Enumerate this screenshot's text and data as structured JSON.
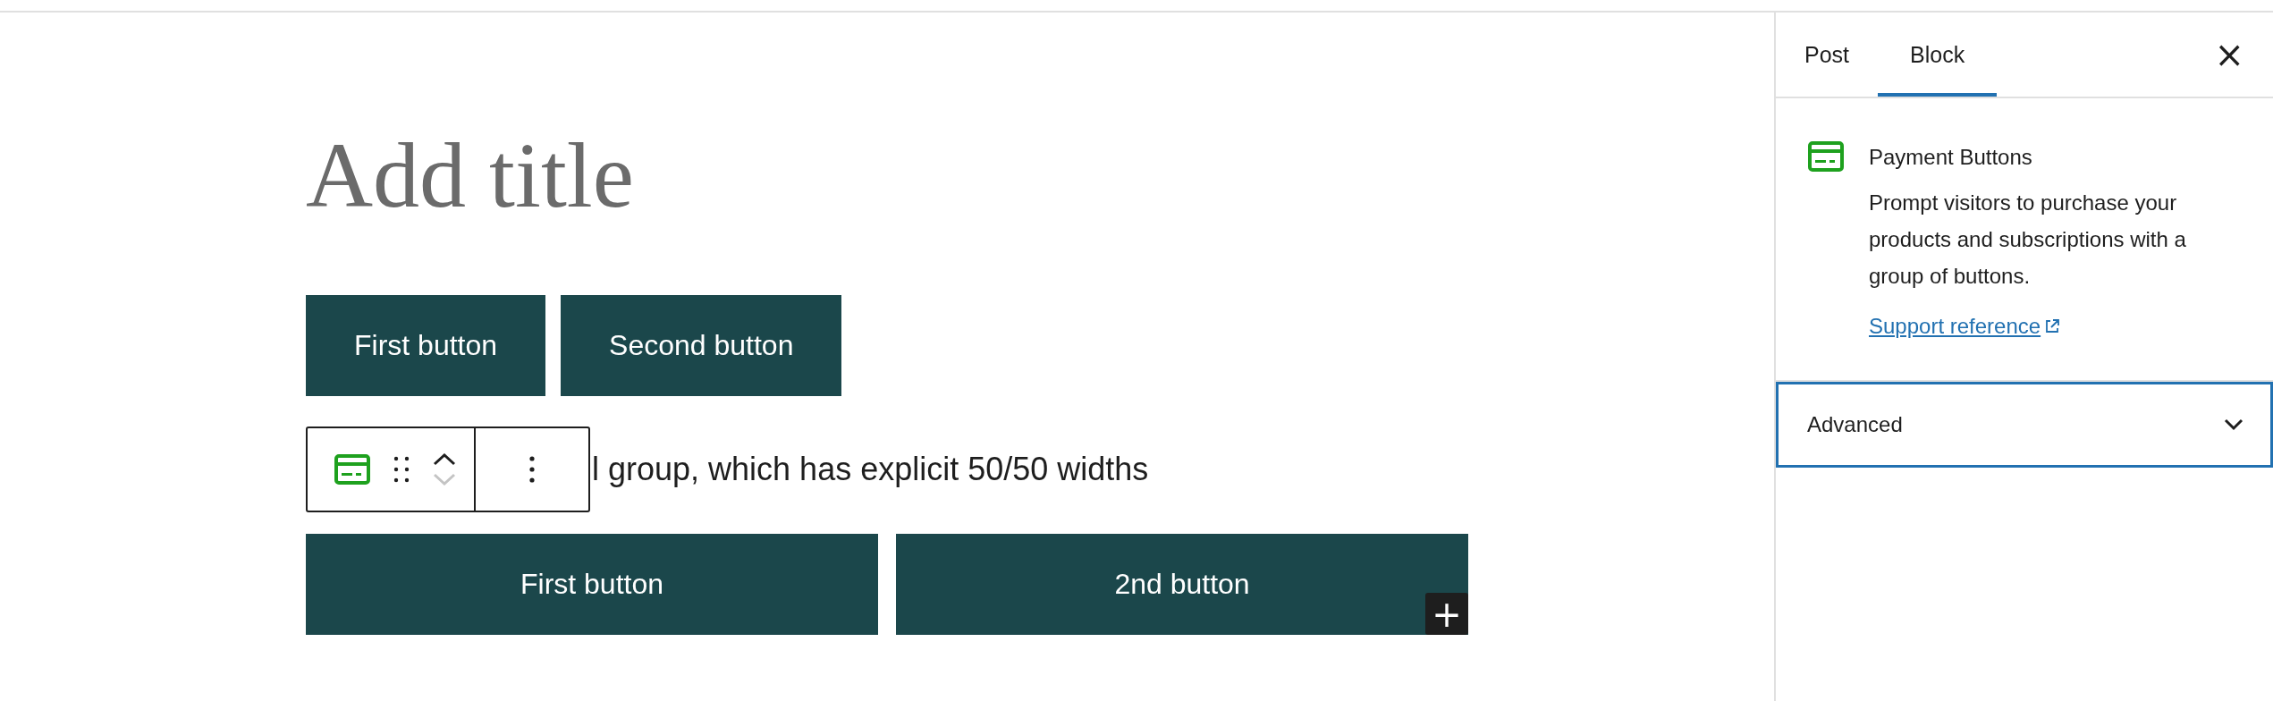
{
  "editor": {
    "title_placeholder": "Add title",
    "button_rows": [
      {
        "kind": "auto",
        "buttons": [
          "First button",
          "Second button"
        ]
      },
      {
        "kind": "equal",
        "buttons": [
          "First button",
          "2nd button"
        ]
      }
    ],
    "paragraph": "l group, which has explicit 50/50 widths",
    "toolbar": {
      "movers": [
        {
          "kind": "up",
          "disabled": false
        },
        {
          "kind": "down",
          "disabled": true
        }
      ]
    },
    "inserter": "+"
  },
  "sidebar": {
    "tabs": [
      {
        "label": "Post",
        "selected": false
      },
      {
        "label": "Block",
        "selected": true
      }
    ],
    "close": "×",
    "block": {
      "name": "Payment Buttons",
      "description": "Prompt visitors to purchase your products and subscriptions with a group of buttons.",
      "link": "Support reference"
    },
    "panels": [
      {
        "title": "Advanced",
        "expanded": false
      }
    ]
  }
}
